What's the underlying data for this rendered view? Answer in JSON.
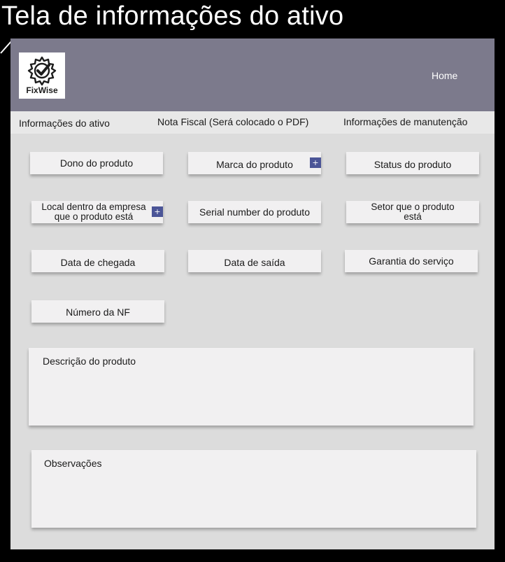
{
  "frame": {
    "title": "Tela de informações do ativo"
  },
  "header": {
    "logo_text": "FixWise",
    "logo_icon": "gear-check-icon",
    "home_label": "Home",
    "bar_color": "#7c7a8c"
  },
  "tabs": [
    {
      "label": "Informações do ativo"
    },
    {
      "label": "Nota Fiscal (Será colocado o PDF)"
    },
    {
      "label": "Informações de manutenção"
    }
  ],
  "fields": {
    "owner": "Dono do produto",
    "brand": "Marca do produto",
    "status": "Status do produto",
    "location": "Local dentro da empresa que o produto está",
    "serial": "Serial number do produto",
    "sector": "Setor que o produto está",
    "arrival_date": "Data de chegada",
    "exit_date": "Data de saída",
    "warranty": "Garantia do serviço",
    "invoice_number": "Número da NF"
  },
  "add_button": {
    "symbol": "+",
    "color": "#4b5597"
  },
  "description": {
    "label": "Descrição do produto"
  },
  "observations": {
    "label": "Observações"
  }
}
